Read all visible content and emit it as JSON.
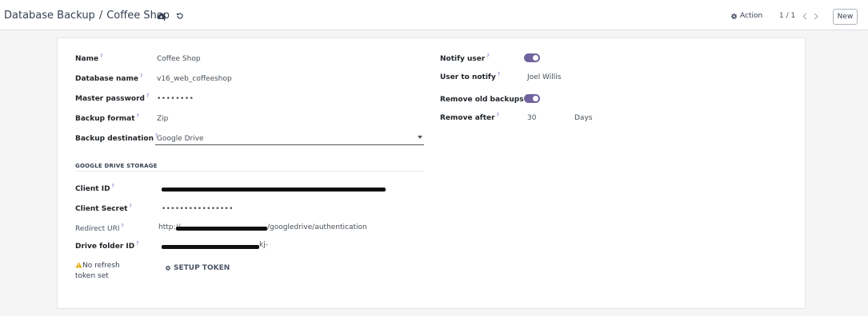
{
  "topbar": {
    "breadcrumb_parent": "Database Backup",
    "breadcrumb_separator": "/",
    "breadcrumb_current": "Coffee Shop",
    "action_label": "Action",
    "pager": "1 / 1",
    "new_label": "New"
  },
  "form": {
    "name_label": "Name",
    "name_value": "Coffee Shop",
    "db_label": "Database name",
    "db_value": "v16_web_coffeeshop",
    "master_pw_label": "Master password",
    "master_pw_value": "••••••••",
    "format_label": "Backup format",
    "format_value": "Zip",
    "destination_label": "Backup destination",
    "destination_value": "Google Drive",
    "notify_label": "Notify user",
    "notify_on": true,
    "user_notify_label": "User to notify",
    "user_notify_value": "Joel Willis",
    "remove_old_label": "Remove old backups",
    "remove_old_on": true,
    "remove_after_label": "Remove after",
    "remove_after_value": "30",
    "remove_after_unit": "Days",
    "help_mark": "?"
  },
  "gdrive": {
    "section_title": "GOOGLE DRIVE STORAGE",
    "client_id_label": "Client ID",
    "client_secret_label": "Client Secret",
    "client_secret_value": "••••••••••••••••",
    "redirect_label": "Redirect URI",
    "redirect_prefix": "http://",
    "redirect_suffix": "/googledrive/authentication",
    "folder_label": "Drive folder ID",
    "folder_suffix": "kj-",
    "warning_text": "No refresh token set",
    "setup_label": "SETUP TOKEN"
  },
  "colors": {
    "accent": "#71639e",
    "help": "#6f42c1"
  }
}
